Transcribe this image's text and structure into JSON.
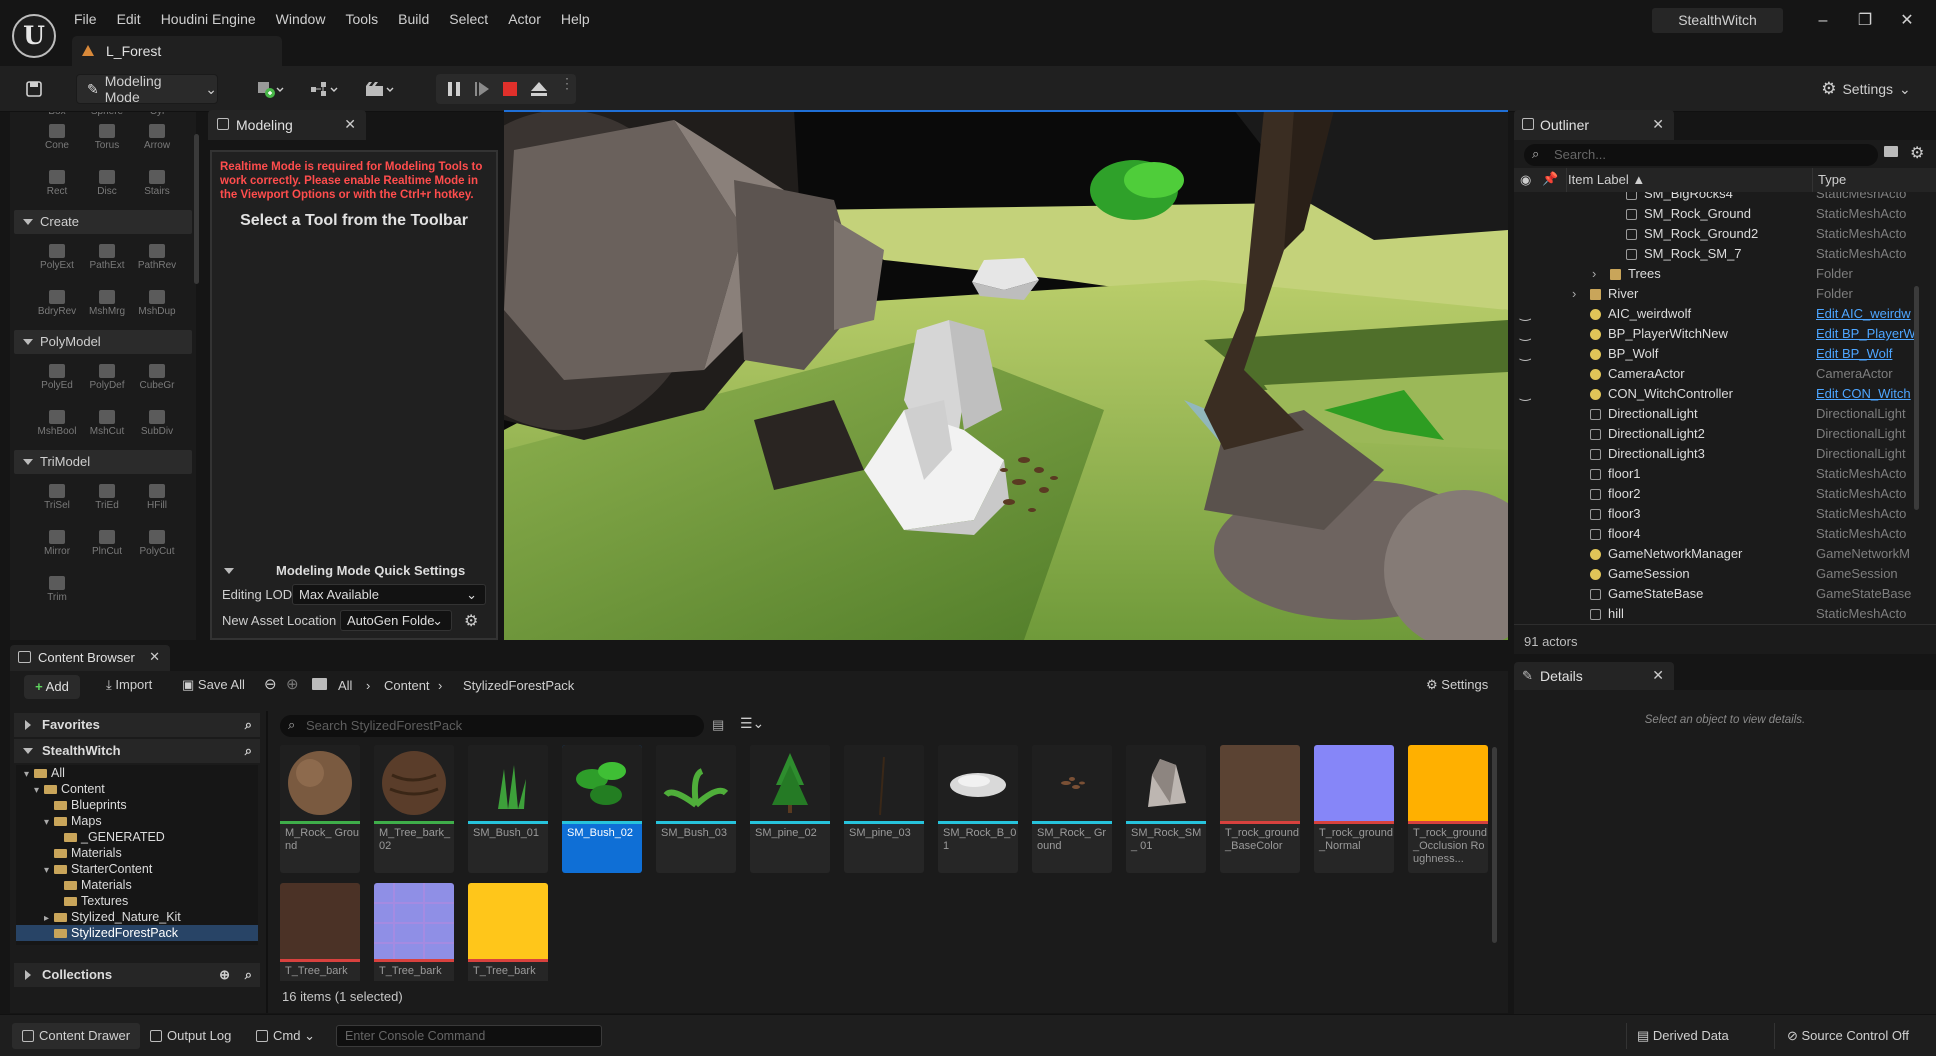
{
  "app": {
    "project": "StealthWitch",
    "level_tab": "L_Forest"
  },
  "menu": [
    "File",
    "Edit",
    "Houdini Engine",
    "Window",
    "Tools",
    "Build",
    "Select",
    "Actor",
    "Help"
  ],
  "toolbar": {
    "mode_label": "Modeling Mode",
    "settings_label": "Settings"
  },
  "palette": {
    "top_partial": [
      "Box",
      "Sphere",
      "Cyl"
    ],
    "shapes": [
      "Cone",
      "Torus",
      "Arrow",
      "Rect",
      "Disc",
      "Stairs"
    ],
    "sections": [
      {
        "title": "Create",
        "tools": [
          "PolyExt",
          "PathExt",
          "PathRev",
          "BdryRev",
          "MshMrg",
          "MshDup"
        ]
      },
      {
        "title": "PolyModel",
        "tools": [
          "PolyEd",
          "PolyDef",
          "CubeGr",
          "MshBool",
          "MshCut",
          "SubDiv"
        ]
      },
      {
        "title": "TriModel",
        "tools": [
          "TriSel",
          "TriEd",
          "HFill",
          "Mirror",
          "PlnCut",
          "PolyCut",
          "Trim"
        ]
      }
    ]
  },
  "modeling": {
    "tab": "Modeling",
    "warning": "Realtime Mode is required for Modeling Tools to work correctly. Please enable Realtime Mode in the Viewport Options or with the Ctrl+r hotkey.",
    "select_tool": "Select a Tool from the Toolbar",
    "quick_settings": "Modeling Mode Quick Settings",
    "editing_lod_label": "Editing LOD",
    "editing_lod_value": "Max Available",
    "new_asset_label": "New Asset Location",
    "new_asset_value": "AutoGen Folde"
  },
  "outliner": {
    "tab": "Outliner",
    "search_placeholder": "Search...",
    "col_label": "Item Label ▲",
    "col_type": "Type",
    "rows": [
      {
        "name": "SM_BigRocks4",
        "type": "StaticMeshActo",
        "indent": 2
      },
      {
        "name": "SM_Rock_Ground",
        "type": "StaticMeshActo",
        "indent": 2
      },
      {
        "name": "SM_Rock_Ground2",
        "type": "StaticMeshActo",
        "indent": 2
      },
      {
        "name": "SM_Rock_SM_7",
        "type": "StaticMeshActo",
        "indent": 2
      },
      {
        "name": "Trees",
        "type": "Folder",
        "indent": 1,
        "kind": "folder"
      },
      {
        "name": "River",
        "type": "Folder",
        "indent": 0,
        "kind": "folder"
      },
      {
        "name": "AIC_weirdwolf",
        "type": "Edit AIC_weirdw",
        "indent": 0,
        "kind": "actor",
        "link": true
      },
      {
        "name": "BP_PlayerWitchNew",
        "type": "Edit BP_PlayerW",
        "indent": 0,
        "kind": "actor",
        "link": true
      },
      {
        "name": "BP_Wolf",
        "type": "Edit BP_Wolf",
        "indent": 0,
        "kind": "actor",
        "link": true
      },
      {
        "name": "CameraActor",
        "type": "CameraActor",
        "indent": 0,
        "kind": "actor"
      },
      {
        "name": "CON_WitchController",
        "type": "Edit CON_Witch",
        "indent": 0,
        "kind": "actor",
        "link": true
      },
      {
        "name": "DirectionalLight",
        "type": "DirectionalLight",
        "indent": 0
      },
      {
        "name": "DirectionalLight2",
        "type": "DirectionalLight",
        "indent": 0
      },
      {
        "name": "DirectionalLight3",
        "type": "DirectionalLight",
        "indent": 0
      },
      {
        "name": "floor1",
        "type": "StaticMeshActo",
        "indent": 0
      },
      {
        "name": "floor2",
        "type": "StaticMeshActo",
        "indent": 0
      },
      {
        "name": "floor3",
        "type": "StaticMeshActo",
        "indent": 0
      },
      {
        "name": "floor4",
        "type": "StaticMeshActo",
        "indent": 0
      },
      {
        "name": "GameNetworkManager",
        "type": "GameNetworkM",
        "indent": 0,
        "kind": "actor"
      },
      {
        "name": "GameSession",
        "type": "GameSession",
        "indent": 0,
        "kind": "actor"
      },
      {
        "name": "GameStateBase",
        "type": "GameStateBase",
        "indent": 0
      },
      {
        "name": "hill",
        "type": "StaticMeshActo",
        "indent": 0
      }
    ],
    "count": "91 actors"
  },
  "details": {
    "tab": "Details",
    "empty": "Select an object to view details."
  },
  "content_browser": {
    "tab": "Content Browser",
    "add": "Add",
    "import": "Import",
    "save_all": "Save All",
    "breadcrumbs": [
      "All",
      "Content",
      "StylizedForestPack"
    ],
    "settings": "Settings",
    "favorites": "Favorites",
    "project": "StealthWitch",
    "collections": "Collections",
    "search_placeholder": "Search StylizedForestPack",
    "tree": [
      {
        "name": "All",
        "depth": 0
      },
      {
        "name": "Content",
        "depth": 1
      },
      {
        "name": "Blueprints",
        "depth": 2
      },
      {
        "name": "Maps",
        "depth": 2
      },
      {
        "name": "_GENERATED",
        "depth": 3
      },
      {
        "name": "Materials",
        "depth": 2
      },
      {
        "name": "StarterContent",
        "depth": 2
      },
      {
        "name": "Materials",
        "depth": 3
      },
      {
        "name": "Textures",
        "depth": 3
      },
      {
        "name": "Stylized_Nature_Kit",
        "depth": 2
      },
      {
        "name": "StylizedForestPack",
        "depth": 2,
        "selected": true
      }
    ],
    "assets": [
      {
        "name": "M_Rock_ Ground",
        "bar": "#3fae4a",
        "thumb": "sphere-rock"
      },
      {
        "name": "M_Tree_bark_ 02",
        "bar": "#3fae4a",
        "thumb": "sphere-bark"
      },
      {
        "name": "SM_Bush_01",
        "bar": "#27c3dc",
        "thumb": "grass"
      },
      {
        "name": "SM_Bush_02",
        "bar": "#27c3dc",
        "thumb": "bush",
        "selected": true
      },
      {
        "name": "SM_Bush_03",
        "bar": "#27c3dc",
        "thumb": "fern"
      },
      {
        "name": "SM_pine_02",
        "bar": "#27c3dc",
        "thumb": "pine"
      },
      {
        "name": "SM_pine_03",
        "bar": "#27c3dc",
        "thumb": "stick"
      },
      {
        "name": "SM_Rock_B_01",
        "bar": "#27c3dc",
        "thumb": "flat-rock"
      },
      {
        "name": "SM_Rock_ Ground",
        "bar": "#27c3dc",
        "thumb": "pebbles"
      },
      {
        "name": "SM_Rock_SM_ 01",
        "bar": "#27c3dc",
        "thumb": "tall-rock"
      },
      {
        "name": "T_rock_ground _BaseColor",
        "bar": "#d8413e",
        "thumb": "tex-brown"
      },
      {
        "name": "T_rock_ground _Normal",
        "bar": "#d8413e",
        "thumb": "tex-normal"
      },
      {
        "name": "T_rock_ground _Occlusion Roughness...",
        "bar": "#d8413e",
        "thumb": "tex-orange"
      },
      {
        "name": "T_Tree_bark",
        "bar": "#d8413e",
        "thumb": "tex-bark"
      },
      {
        "name": "T_Tree_bark",
        "bar": "#d8413e",
        "thumb": "tex-normal-bark"
      },
      {
        "name": "T_Tree_bark",
        "bar": "#d8413e",
        "thumb": "tex-yellow"
      }
    ],
    "count": "16 items (1 selected)"
  },
  "status": {
    "content_drawer": "Content Drawer",
    "output_log": "Output Log",
    "cmd": "Cmd",
    "console_placeholder": "Enter Console Command",
    "derived_data": "Derived Data",
    "source_control": "Source Control Off"
  }
}
